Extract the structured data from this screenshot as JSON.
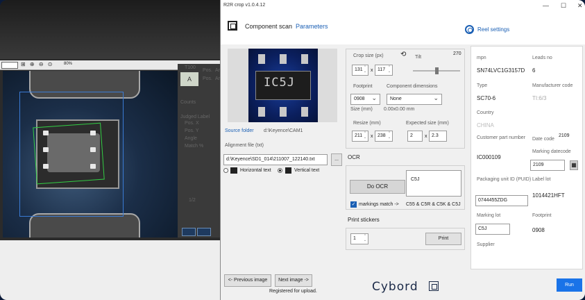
{
  "window": {
    "title": "R2R crop v1.0.4.12",
    "minimize": "—",
    "maximize": "☐",
    "close": "✕"
  },
  "header": {
    "title": "Component scan",
    "params_link": "Parameters",
    "reel_settings": "Reel settings"
  },
  "background_app": {
    "zoom": "80%",
    "side_label": "T100",
    "side_pos1": "Pos.",
    "side_pos1b": "Ar",
    "side_pos2": "Pos.",
    "side_pos2b": "Ar",
    "counts": "Counts",
    "judged": "Judged Label",
    "pos_x": "Pos. X",
    "pos_y": "Pos. Y",
    "angle": "Angle",
    "match": "Match %",
    "page": "1/2",
    "preview_letter": "A"
  },
  "preview": {
    "marking": "IC5J"
  },
  "source": {
    "label": "Source folder",
    "path": "d:\\Keyence\\CAM1"
  },
  "alignment": {
    "label": "Alignment file (txt)",
    "value": "d:\\Keyence\\SD1_014\\211007_122140.txt",
    "browse": "..."
  },
  "orientation": {
    "horizontal": "Horizontal text",
    "vertical": "Vertical text"
  },
  "crop": {
    "size_label": "Crop size (px)",
    "width": "131",
    "height": "117",
    "x": "x",
    "tilt_label": "Tilt",
    "tilt_value": "270",
    "footprint_label": "Footprint",
    "footprint_value": "0908",
    "dims_label": "Component dimensions",
    "dims_value": "None",
    "size_mm_label": "Size (mm)",
    "size_mm_value": "0.00x0.00 mm",
    "resize_label": "Resize (mm)",
    "resize_w": "211",
    "resize_h": "238",
    "expected_label": "Expected size (mm)",
    "expected_w": "2",
    "expected_h": "2.3"
  },
  "ocr": {
    "label": "OCR",
    "button": "Do OCR",
    "result": "C5J",
    "markings_label": "markings match ->",
    "markings_value": "C55 & C5R & C5K & C5J"
  },
  "stickers": {
    "label": "Print stickers",
    "count": "1",
    "button": "Print"
  },
  "details": {
    "mpn_label": "mpn",
    "mpn_value": "SN74LVC1G3157D",
    "leads_label": "Leads no",
    "leads_value": "6",
    "type_label": "Type",
    "type_value": "SC70-6",
    "mfr_label": "Manufacturer code",
    "mfr_value": "TI:6/3",
    "country_label": "Country",
    "country_value": "CHINA",
    "datecode_label": "Date code",
    "datecode_value": "2109",
    "cpn_label": "Customer part number",
    "cpn_value": "IC000109",
    "marking_datecode_label": "Marking datecode",
    "marking_datecode_value": "2109",
    "puid_label": "Packaging unit ID (PUID)",
    "puid_value": "0744455ZDG",
    "label_lot_label": "Label lot",
    "label_lot_value": "1014421HFT",
    "marking_lot_label": "Marking lot",
    "marking_lot_value": "C5J",
    "footprint_label": "Footprint",
    "footprint_value": "0908",
    "supplier_label": "Supplier"
  },
  "nav": {
    "prev": "<- Previous image",
    "next": "Next image ->",
    "status": "Registered for upload."
  },
  "brand": "Cybord",
  "run": "Run"
}
